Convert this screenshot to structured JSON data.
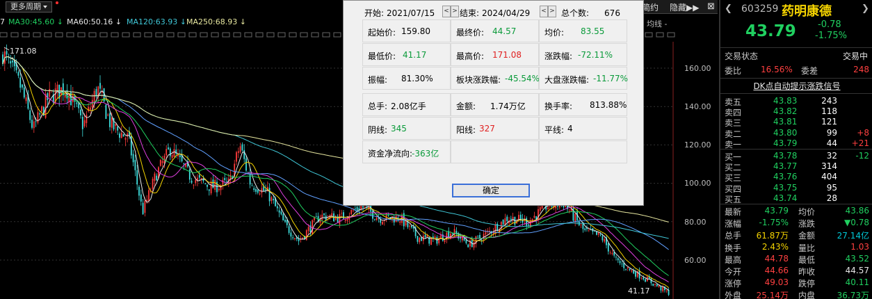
{
  "toolbar": {
    "period_label": "更多周期"
  },
  "ma_legend": {
    "lead": "7",
    "ma30": "MA30:45.60 ↓",
    "ma60": "MA60:50.16 ↓",
    "ma120": "MA120:63.93 ↓",
    "ma250": "MA250:68.93 ↓"
  },
  "top_tabs": {
    "tab1": "简约",
    "tab2": "隐藏▶▶",
    "close": "⊠",
    "indicator": "均线 -"
  },
  "chart": {
    "high_label": "171.08",
    "low_label": "41.17",
    "y_ticks": [
      "160.00",
      "140.00",
      "120.00",
      "100.00",
      "80.00",
      "60.00"
    ]
  },
  "dialog": {
    "start_label": "开始:",
    "start_value": "2021/07/15",
    "end_label": "结束:",
    "end_value": "2024/04/29",
    "count_label": "总个数:",
    "count_value": "676",
    "spin_prev": "<",
    "spin_next": ">",
    "rows": [
      [
        {
          "label": "起始价:",
          "value": "159.80",
          "color": "black"
        },
        {
          "label": "最终价:",
          "value": "44.57",
          "color": "green"
        },
        {
          "label": "均价:",
          "value": "83.55",
          "color": "green"
        }
      ],
      [
        {
          "label": "最低价:",
          "value": "41.17",
          "color": "green"
        },
        {
          "label": "最高价:",
          "value": "171.08",
          "color": "red"
        },
        {
          "label": "涨跌幅:",
          "value": "-72.11%",
          "color": "green"
        }
      ],
      [
        {
          "label": "振幅:",
          "value": "81.30%",
          "color": "black"
        },
        {
          "label": "板块涨跌幅:",
          "value": "-45.54%",
          "color": "green"
        },
        {
          "label": "大盘涨跌幅:",
          "value": "-11.77%",
          "color": "green"
        }
      ],
      [
        {
          "label": "总手:",
          "value": "2.08亿手",
          "color": "black"
        },
        {
          "label": "金额:",
          "value": "1.74万亿",
          "color": "black"
        },
        {
          "label": "换手率:",
          "value": "813.88%",
          "color": "black"
        }
      ],
      [
        {
          "label": "阴线:",
          "value": "345",
          "color": "green"
        },
        {
          "label": "阳线:",
          "value": "327",
          "color": "red"
        },
        {
          "label": "平线:",
          "value": "4",
          "color": "black"
        }
      ],
      [
        {
          "label": "资金净流向:",
          "value": "-363亿",
          "color": "green"
        }
      ]
    ],
    "ok_label": "确定"
  },
  "quote": {
    "code": "603259",
    "name": "药明康德",
    "price": "43.79",
    "change": "-0.78",
    "change_pct": "-1.75%",
    "status_label": "交易状态",
    "status_value": "交易中",
    "weibi_label": "委比",
    "weibi_value": "16.56%",
    "weicha_label": "委差",
    "weicha_value": "248",
    "signal_link": "DK点自动提示涨跌信号",
    "asks": [
      {
        "label": "卖五",
        "price": "43.83",
        "vol": "243",
        "delta": ""
      },
      {
        "label": "卖四",
        "price": "43.82",
        "vol": "118",
        "delta": ""
      },
      {
        "label": "卖三",
        "price": "43.81",
        "vol": "121",
        "delta": ""
      },
      {
        "label": "卖二",
        "price": "43.80",
        "vol": "99",
        "delta": "+8"
      },
      {
        "label": "卖一",
        "price": "43.79",
        "vol": "44",
        "delta": "+21"
      }
    ],
    "bids": [
      {
        "label": "买一",
        "price": "43.78",
        "vol": "32",
        "delta": "-12"
      },
      {
        "label": "买二",
        "price": "43.77",
        "vol": "314",
        "delta": ""
      },
      {
        "label": "买三",
        "price": "43.76",
        "vol": "404",
        "delta": ""
      },
      {
        "label": "买四",
        "price": "43.75",
        "vol": "95",
        "delta": ""
      },
      {
        "label": "买五",
        "price": "43.74",
        "vol": "28",
        "delta": ""
      }
    ],
    "stats": [
      {
        "l1": "最新",
        "v1": "43.79",
        "c1": "qgreen",
        "l2": "均价",
        "v2": "43.86",
        "c2": "qgreen"
      },
      {
        "l1": "涨幅",
        "v1": "-1.75%",
        "c1": "qgreen",
        "l2": "涨跌",
        "v2": "▼0.78",
        "c2": "qgreen"
      },
      {
        "l1": "总手",
        "v1": "61.87万",
        "c1": "yellow",
        "l2": "金额",
        "v2": "27.14亿",
        "c2": "cyan"
      },
      {
        "l1": "换手",
        "v1": "2.43%",
        "c1": "yellow",
        "l2": "量比",
        "v2": "1.03",
        "c2": "qred"
      },
      {
        "l1": "最高",
        "v1": "44.78",
        "c1": "qred",
        "l2": "最低",
        "v2": "43.52",
        "c2": "qgreen"
      },
      {
        "l1": "今开",
        "v1": "44.66",
        "c1": "qred",
        "l2": "昨收",
        "v2": "44.57",
        "c2": "white"
      },
      {
        "l1": "涨停",
        "v1": "49.03",
        "c1": "qred",
        "l2": "跌停",
        "v2": "40.11",
        "c2": "qgreen"
      },
      {
        "l1": "外盘",
        "v1": "25.14万",
        "c1": "qred",
        "l2": "内盘",
        "v2": "36.73万",
        "c2": "qgreen"
      }
    ]
  },
  "colors": {
    "up": "#ff3b3b",
    "down": "#3fe0e0",
    "ma5": "#e8e8e8",
    "ma10": "#f5d400",
    "ma20": "#e040e0",
    "ma30": "#20d060",
    "ma60": "#60a0ff",
    "ma120": "#40c8d8",
    "ma250": "#e8e8a0"
  }
}
